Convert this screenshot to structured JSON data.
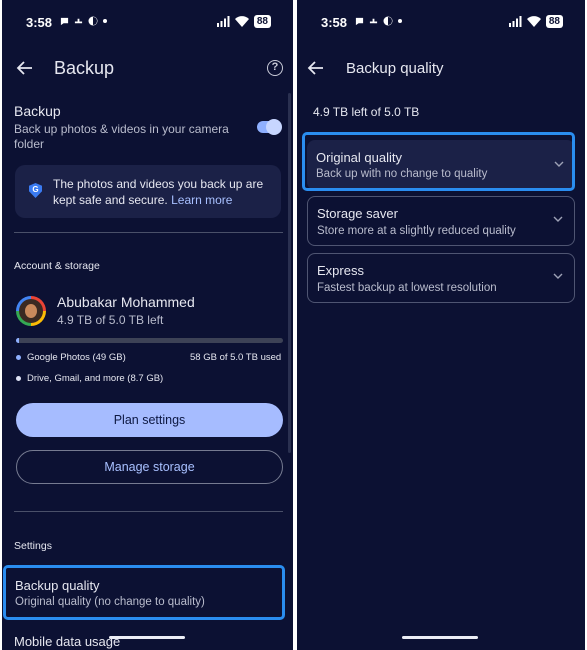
{
  "status_bar": {
    "time": "3:58",
    "battery": "88"
  },
  "left_screen": {
    "title": "Backup",
    "backup": {
      "title": "Backup",
      "subtitle": "Back up photos & videos in your camera folder",
      "enabled": true
    },
    "info": {
      "text": "The photos and videos you back up are kept safe and secure.",
      "link": "Learn more"
    },
    "account_section_label": "Account & storage",
    "account": {
      "name": "Abubakar Mohammed",
      "storage_left": "4.9 TB of 5.0 TB left"
    },
    "storage": {
      "used_fraction": 0.012,
      "legend": [
        {
          "label": "Google Photos (49 GB)",
          "color": "#8fb0ff"
        },
        {
          "label": "Drive, Gmail, and more (8.7 GB)",
          "color": "#dfe3f5"
        }
      ],
      "used_text": "58 GB of 5.0 TB used"
    },
    "plan_button": "Plan settings",
    "manage_button": "Manage storage",
    "settings_label": "Settings",
    "backup_quality": {
      "title": "Backup quality",
      "value": "Original quality (no change to quality)"
    },
    "mobile_data": "Mobile data usage"
  },
  "right_screen": {
    "title": "Backup quality",
    "storage_left": "4.9 TB left of 5.0 TB",
    "options": [
      {
        "name": "Original quality",
        "desc": "Back up with no change to quality",
        "selected": true
      },
      {
        "name": "Storage saver",
        "desc": "Store more at a slightly reduced quality",
        "selected": false
      },
      {
        "name": "Express",
        "desc": "Fastest backup at lowest resolution",
        "selected": false
      }
    ]
  },
  "colors": {
    "background": "#0c1133",
    "accent": "#8fb0ff",
    "highlight": "#2a8df0",
    "card": "#1b2147"
  }
}
